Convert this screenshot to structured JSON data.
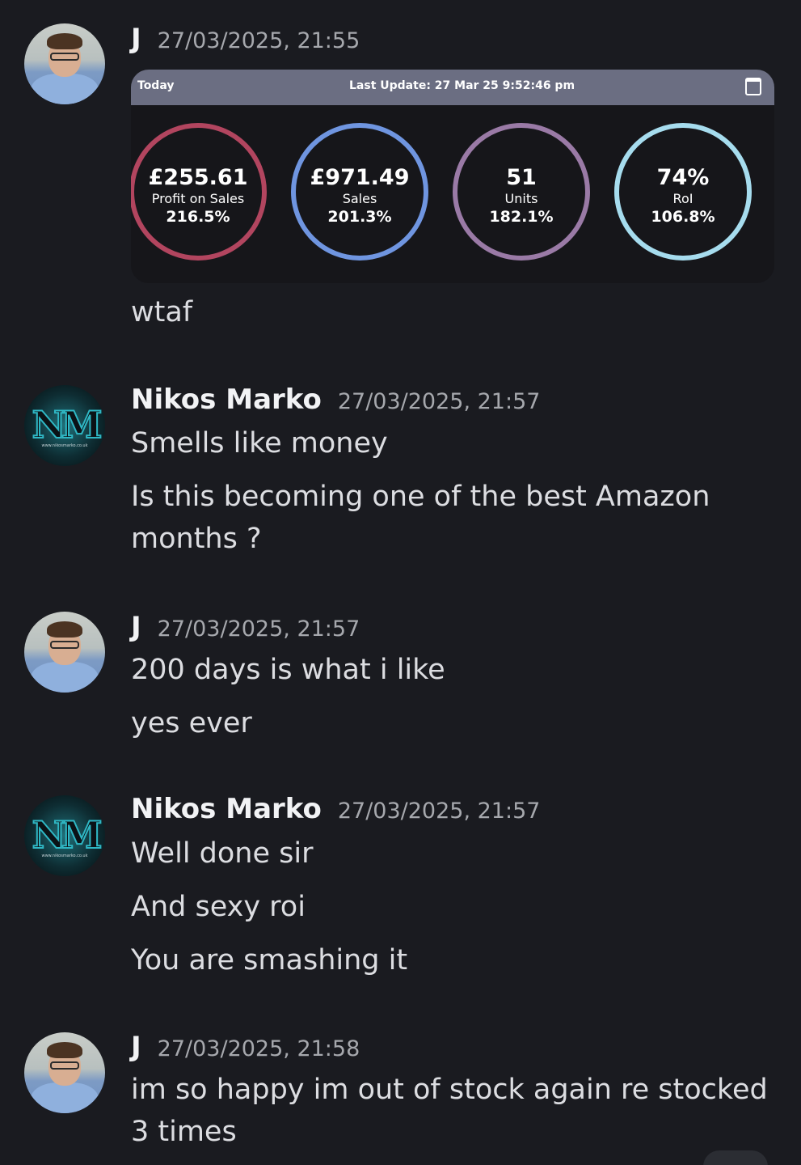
{
  "messages": [
    {
      "author": "J",
      "timestamp": "27/03/2025, 21:55",
      "embed": {
        "left_label": "Today",
        "last_update": "Last Update: 27 Mar 25 9:52:46 pm",
        "icon": "calendar-icon",
        "metrics": [
          {
            "value": "£255.61",
            "label": "Profit on Sales",
            "change": "216.5%",
            "color": "#b2455f"
          },
          {
            "value": "£971.49",
            "label": "Sales",
            "change": "201.3%",
            "color": "#6f95e0"
          },
          {
            "value": "51",
            "label": "Units",
            "change": "182.1%",
            "color": "#9a7aa6"
          },
          {
            "value": "74%",
            "label": "RoI",
            "change": "106.8%",
            "color": "#a6dcee"
          }
        ]
      },
      "lines": [
        "wtaf"
      ]
    },
    {
      "author": "Nikos Marko",
      "timestamp": "27/03/2025, 21:57",
      "avatar_text": "NM",
      "avatar_url": "www.nikosmarko.co.uk",
      "lines": [
        "Smells like money",
        "Is this becoming one of the best Amazon months ?"
      ]
    },
    {
      "author": "J",
      "timestamp": "27/03/2025, 21:57",
      "lines": [
        "200 days is what i like",
        "yes ever"
      ]
    },
    {
      "author": "Nikos Marko",
      "timestamp": "27/03/2025, 21:57",
      "avatar_text": "NM",
      "avatar_url": "www.nikosmarko.co.uk",
      "lines": [
        "Well done sir",
        "And sexy roi",
        "You are smashing it"
      ]
    },
    {
      "author": "J",
      "timestamp": "27/03/2025, 21:58",
      "lines": [
        "im so happy im out of stock again re stocked 3 times"
      ]
    }
  ]
}
